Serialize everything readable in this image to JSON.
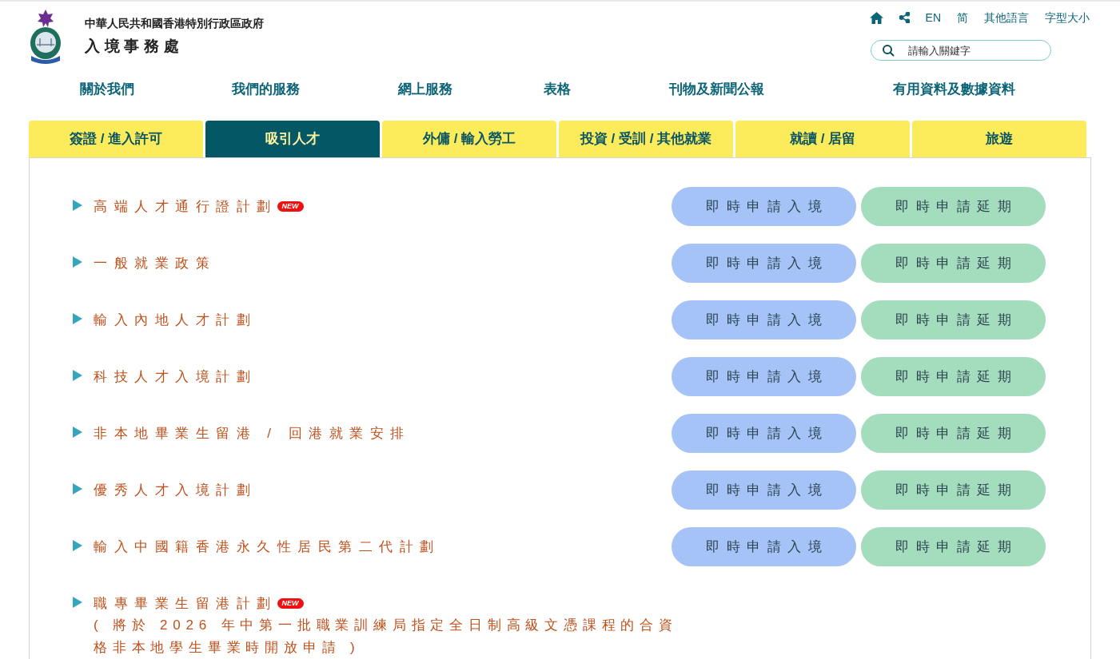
{
  "header": {
    "government": "中華人民共和國香港特別行政區政府",
    "department": "入境事務處"
  },
  "utility": {
    "links": [
      "EN",
      "简",
      "其他語言",
      "字型大小"
    ],
    "search": {
      "placeholder": "請輸入關鍵字"
    }
  },
  "nav": [
    "關於我們",
    "我們的服務",
    "網上服務",
    "表格",
    "刊物及新聞公報",
    "有用資料及數據資料"
  ],
  "tabs": [
    {
      "label": "簽證 / 進入許可",
      "selected": false
    },
    {
      "label": "吸引人才",
      "selected": true
    },
    {
      "label": "外傭 / 輸入勞工",
      "selected": false
    },
    {
      "label": "投資 / 受訓 / 其他就業",
      "selected": false
    },
    {
      "label": "就讀 / 居留",
      "selected": false
    },
    {
      "label": "旅遊",
      "selected": false
    }
  ],
  "schemes": [
    {
      "title": "高端人才通行證計劃",
      "badge": "NEW",
      "buttons": [
        {
          "label": "即時申請入境",
          "kind": "entry"
        },
        {
          "label": "即時申請延期",
          "kind": "extension"
        }
      ]
    },
    {
      "title": "一般就業政策",
      "buttons": [
        {
          "label": "即時申請入境",
          "kind": "entry"
        },
        {
          "label": "即時申請延期",
          "kind": "extension"
        }
      ]
    },
    {
      "title": "輸入內地人才計劃",
      "buttons": [
        {
          "label": "即時申請入境",
          "kind": "entry"
        },
        {
          "label": "即時申請延期",
          "kind": "extension"
        }
      ]
    },
    {
      "title": "科技人才入境計劃",
      "buttons": [
        {
          "label": "即時申請入境",
          "kind": "entry"
        },
        {
          "label": "即時申請延期",
          "kind": "extension"
        }
      ]
    },
    {
      "title": "非本地畢業生留港 / 回港就業安排",
      "buttons": [
        {
          "label": "即時申請入境",
          "kind": "entry"
        },
        {
          "label": "即時申請延期",
          "kind": "extension"
        }
      ]
    },
    {
      "title": "優秀人才入境計劃",
      "buttons": [
        {
          "label": "即時申請入境",
          "kind": "entry"
        },
        {
          "label": "即時申請延期",
          "kind": "extension"
        }
      ]
    },
    {
      "title": "輸入中國籍香港永久性居民第二代計劃",
      "buttons": [
        {
          "label": "即時申請入境",
          "kind": "entry"
        },
        {
          "label": "即時申請延期",
          "kind": "extension"
        }
      ]
    },
    {
      "title": "職專畢業生留港計劃",
      "badge": "NEW",
      "note": "( 將於 2026 年中第一批職業訓練局指定全日制高級文憑課程的合資格非本地學生畢業時開放申請 )"
    }
  ]
}
